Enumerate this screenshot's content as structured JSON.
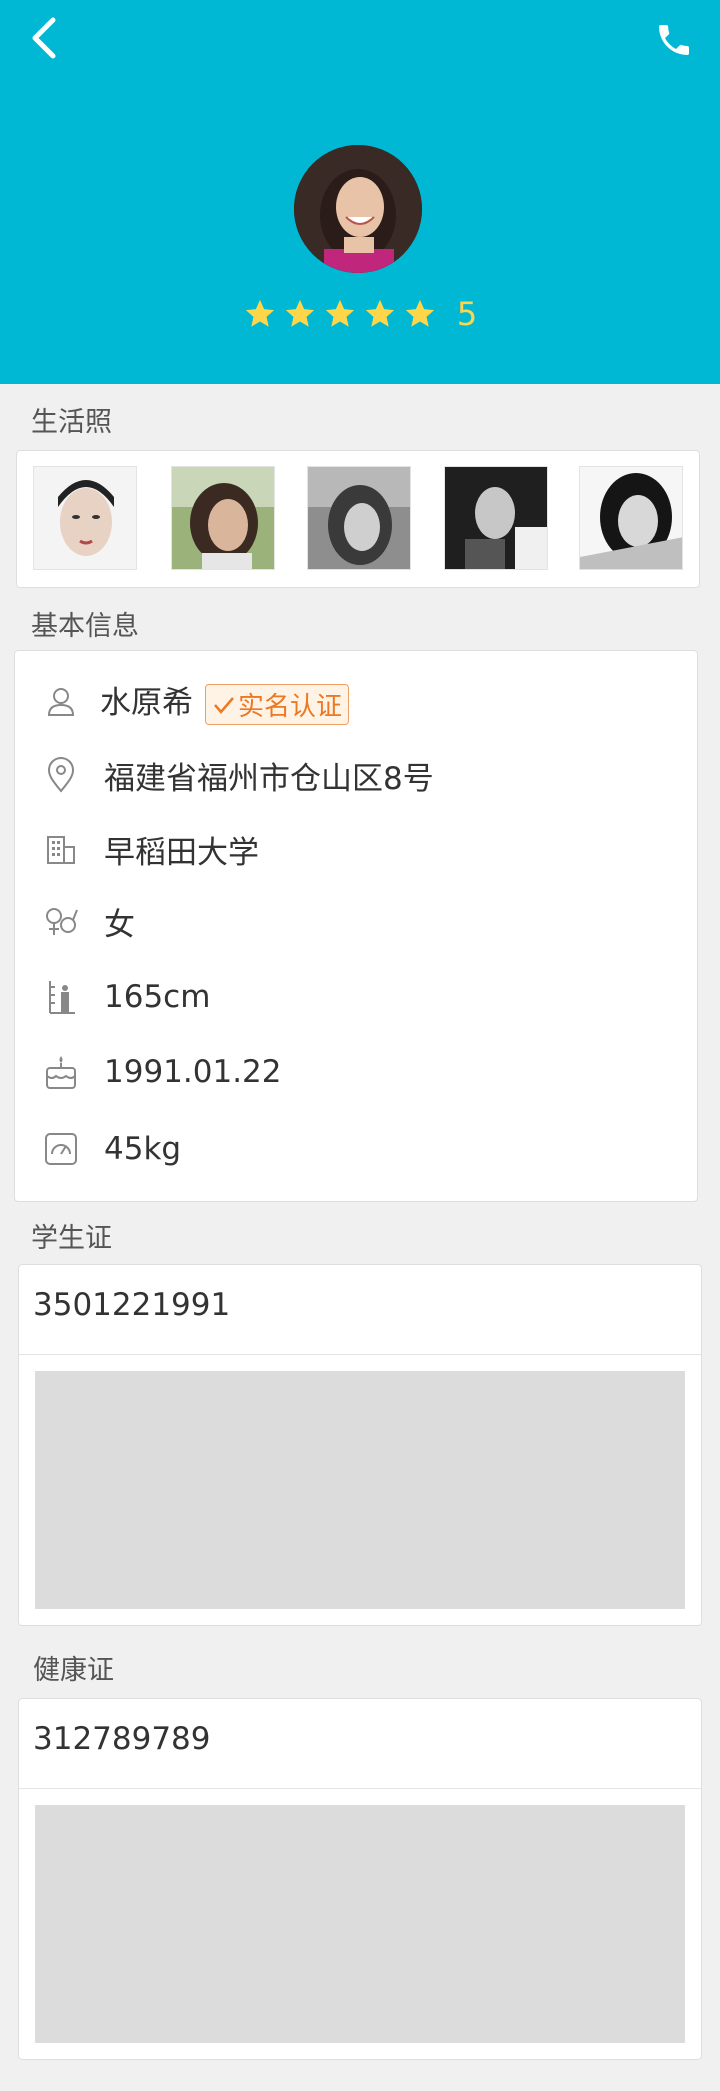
{
  "header": {
    "back_icon": "chevron-left-icon",
    "call_icon": "phone-icon",
    "rating": {
      "stars": 5,
      "score": "5"
    },
    "colors": {
      "header_bg": "#00b8d4",
      "star": "#ffd54a"
    }
  },
  "sections": {
    "photos_title": "生活照",
    "basic_title": "基本信息",
    "student_title": "学生证",
    "health_title": "健康证"
  },
  "basic_info": {
    "name": "水原希",
    "verified_badge": "实名认证",
    "address": "福建省福州市仓山区8号",
    "school": "早稻田大学",
    "gender": "女",
    "height": "165cm",
    "birthday": "1991.01.22",
    "weight": "45kg"
  },
  "student_card": {
    "number": "3501221991"
  },
  "health_card": {
    "number": "312789789"
  },
  "photos": {
    "count": 5
  }
}
